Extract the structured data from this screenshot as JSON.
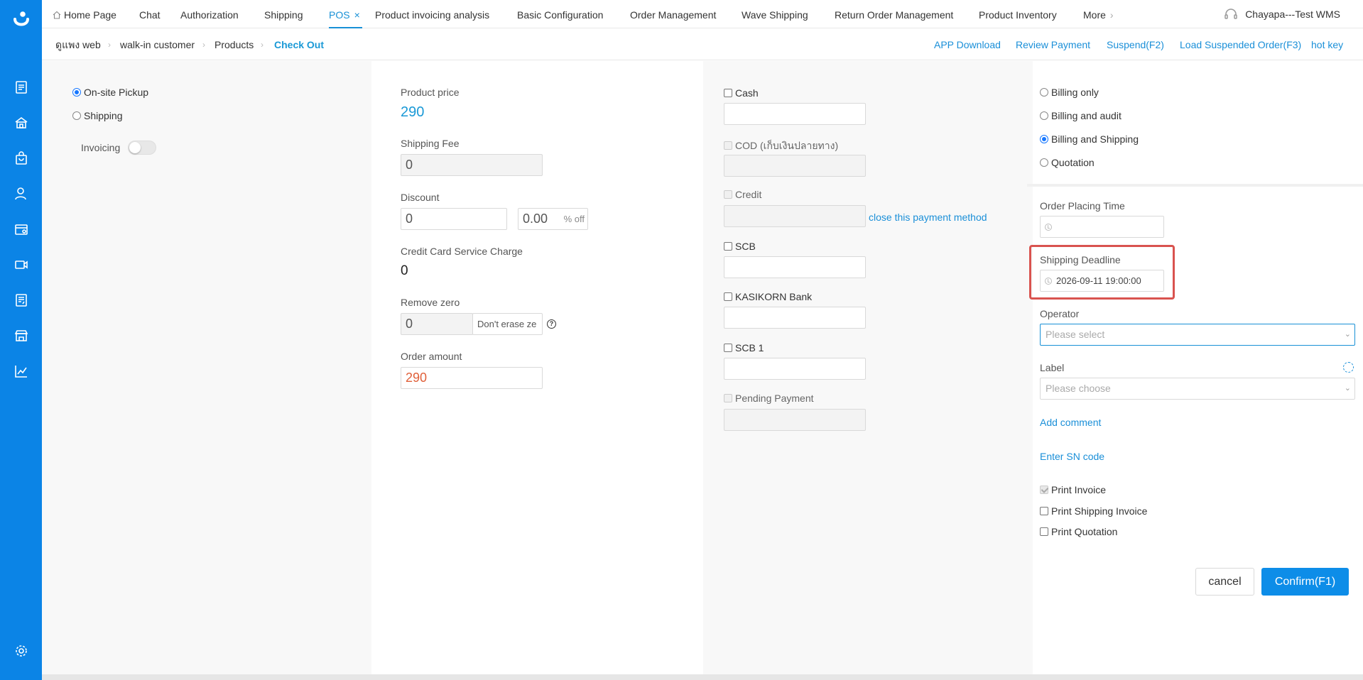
{
  "nav_tabs": [
    {
      "label": "Home Page"
    },
    {
      "label": "Chat"
    },
    {
      "label": "Authorization"
    },
    {
      "label": "Shipping"
    },
    {
      "label": "POS",
      "close": "×"
    },
    {
      "label": "Product invoicing analysis"
    },
    {
      "label": "Basic Configuration"
    },
    {
      "label": "Order Management"
    },
    {
      "label": "Wave Shipping"
    },
    {
      "label": "Return Order Management"
    },
    {
      "label": "Product Inventory"
    },
    {
      "label": "More"
    }
  ],
  "user": {
    "name": "Chayapa---Test WMS"
  },
  "breadcrumb": [
    "ดูแพง web",
    "walk-in customer",
    "Products",
    "Check Out"
  ],
  "actions": [
    "APP Download",
    "Review Payment",
    "Suspend(F2)",
    "Load Suspended Order(F3)",
    "hot key"
  ],
  "delivery": {
    "options": [
      "On-site Pickup",
      "Shipping"
    ],
    "selected": "On-site Pickup",
    "invoicing_label": "Invoicing",
    "invoicing_on": false
  },
  "pricing": {
    "product_price_label": "Product price",
    "product_price": "290",
    "shipping_fee_label": "Shipping Fee",
    "shipping_fee": "0",
    "discount_label": "Discount",
    "discount_amount": "0",
    "discount_percent": "0.00",
    "discount_percent_suffix": "% off",
    "cc_charge_label": "Credit Card Service Charge",
    "cc_charge": "0",
    "remove_zero_label": "Remove zero",
    "remove_zero_value": "0",
    "remove_zero_mode": "Don't erase ze",
    "order_amount_label": "Order amount",
    "order_amount": "290"
  },
  "payments": [
    {
      "label": "Cash",
      "disabled": false
    },
    {
      "label": "COD (เก็บเงินปลายทาง)",
      "disabled": true
    },
    {
      "label": "Credit",
      "disabled": true
    },
    {
      "label": "SCB",
      "disabled": false
    },
    {
      "label": "KASIKORN Bank",
      "disabled": false
    },
    {
      "label": "SCB 1",
      "disabled": false
    },
    {
      "label": "Pending Payment",
      "disabled": true
    }
  ],
  "close_payment_link": "close this payment method",
  "billing": {
    "options": [
      "Billing only",
      "Billing and audit",
      "Billing and Shipping",
      "Quotation"
    ],
    "selected": "Billing and Shipping"
  },
  "order_form": {
    "order_placing_time_label": "Order Placing Time",
    "order_placing_time": "",
    "shipping_deadline_label": "Shipping Deadline",
    "shipping_deadline": "2026-09-11 19:00:00",
    "operator_label": "Operator",
    "operator_placeholder": "Please select",
    "label_label": "Label",
    "label_placeholder": "Please choose",
    "add_comment": "Add comment",
    "enter_sn": "Enter SN code"
  },
  "print_options": [
    {
      "label": "Print Invoice",
      "checked": true,
      "disabled": true
    },
    {
      "label": "Print Shipping Invoice",
      "checked": false
    },
    {
      "label": "Print Quotation",
      "checked": false
    }
  ],
  "buttons": {
    "cancel": "cancel",
    "confirm": "Confirm(F1)"
  },
  "colors": {
    "sidebar": "#0b84e6",
    "accent": "#1890d6",
    "order_amount": "#e0603a",
    "highlight": "#d9534f",
    "confirm": "#0d8de8"
  },
  "icons": [
    "logo-icon",
    "document-icon",
    "home-icon",
    "bag-icon",
    "user-settings-icon",
    "store-settings-icon",
    "video-icon",
    "report-icon",
    "shop-icon",
    "chart-icon",
    "settings-icon",
    "headset-icon"
  ]
}
